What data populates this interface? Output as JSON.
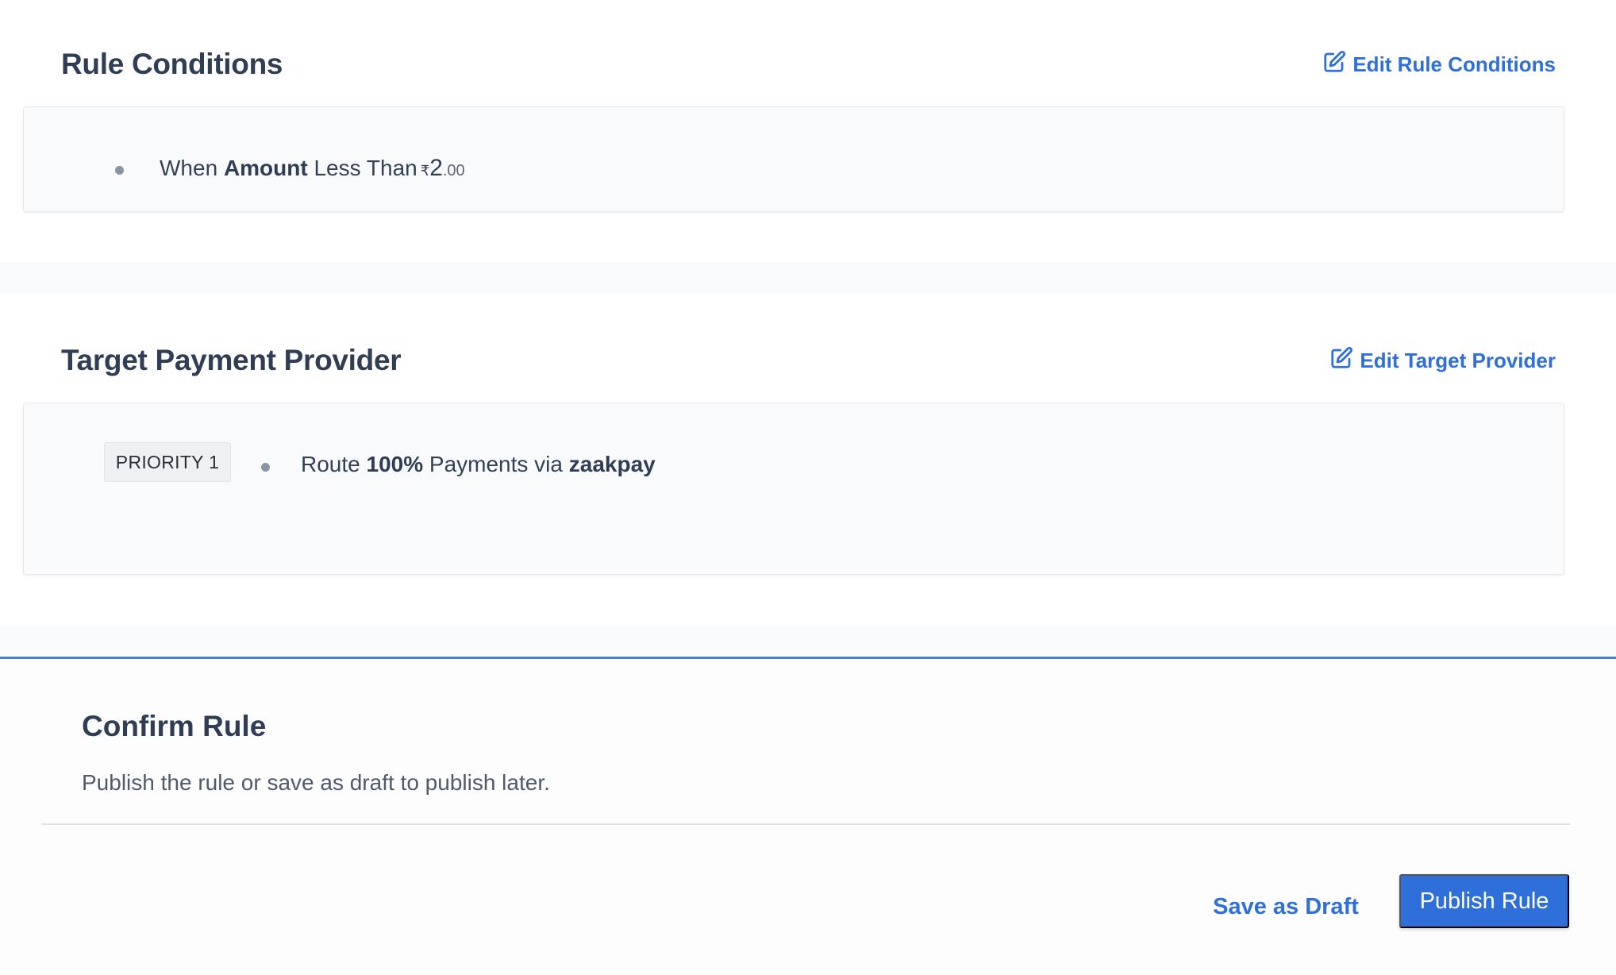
{
  "rule_conditions": {
    "title": "Rule Conditions",
    "edit_label": "Edit Rule Conditions",
    "condition": {
      "prefix": "When",
      "field": "Amount",
      "operator": "Less Than",
      "currency_symbol": "₹",
      "amount_integer": "2",
      "amount_decimal": ".00"
    }
  },
  "target_provider": {
    "title": "Target Payment Provider",
    "edit_label": "Edit Target Provider",
    "priority_label": "PRIORITY 1",
    "route": {
      "prefix": "Route",
      "percentage": "100%",
      "middle": "Payments via",
      "provider": "zaakpay"
    }
  },
  "confirm": {
    "title": "Confirm Rule",
    "description": "Publish the rule or save as draft to publish later.",
    "draft_label": "Save as Draft",
    "publish_label": "Publish Rule"
  },
  "colors": {
    "accent": "#2e6fd9",
    "heading": "#2f3d55",
    "card_bg": "#f9fafc"
  }
}
